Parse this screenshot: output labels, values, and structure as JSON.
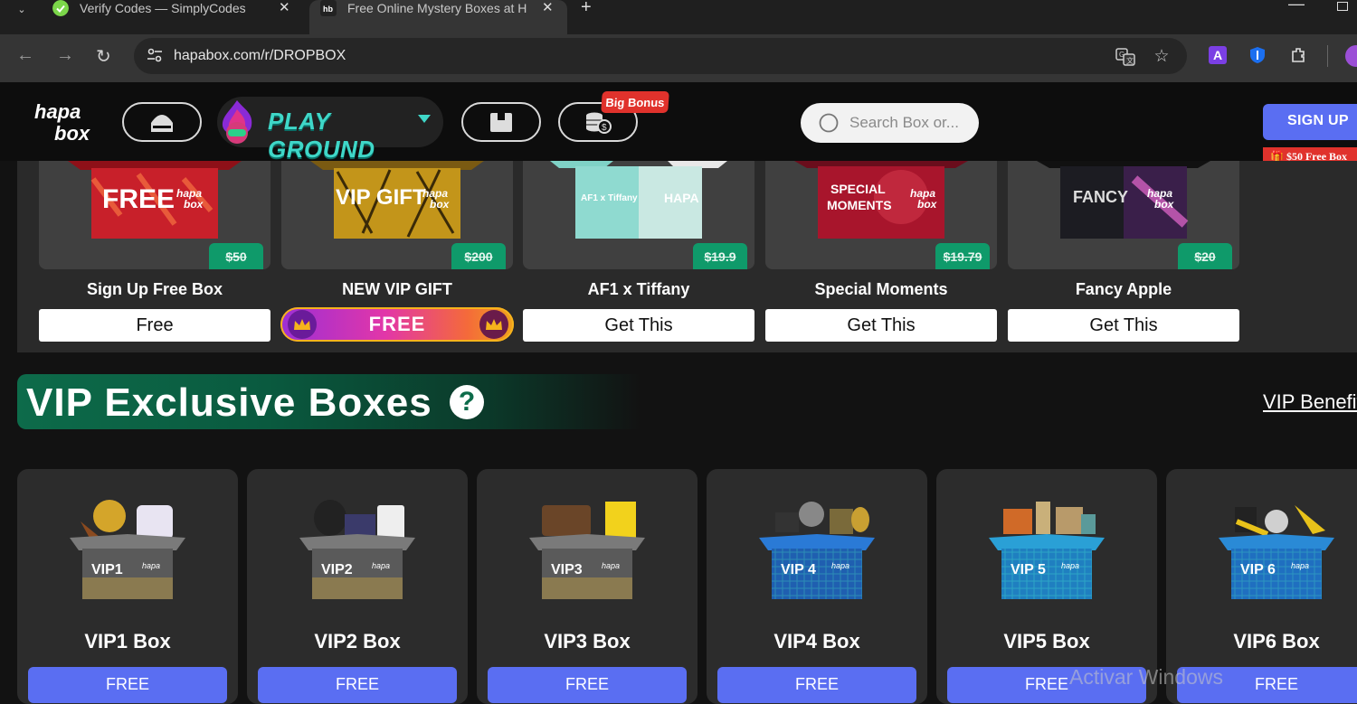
{
  "browser": {
    "tabs": [
      {
        "title": "Verify Codes — SimplyCodes",
        "active": false
      },
      {
        "title": "Free Online Mystery Boxes at H",
        "active": true
      }
    ],
    "new_tab": "+",
    "url": "hapabox.com/r/DROPBOX",
    "icons": [
      "tab-list-icon",
      "back-icon",
      "forward-icon",
      "reload-icon",
      "site-info-icon",
      "translate-icon",
      "bookmark-star-icon",
      "extension-a-icon",
      "bitwarden-icon",
      "extensions-puzzle-icon",
      "profile-icon",
      "minimize-icon",
      "restore-icon"
    ]
  },
  "header": {
    "logo_text": "hapa box",
    "playground_label": "PLAY GROUND",
    "bonus_badge": "Big Bonus",
    "search_placeholder": "Search Box or...",
    "signup_label": "SIGN UP",
    "signup_promo": "🎁 $50 Free Box",
    "accent": "#5a6ef2",
    "icons": [
      "home-icon",
      "store-icon",
      "coins-icon",
      "search-icon"
    ]
  },
  "free_boxes": [
    {
      "name": "Sign Up Free Box",
      "price": "$50",
      "button": "Free",
      "art_text": "FREE",
      "color": "#c8202a"
    },
    {
      "name": "NEW VIP GIFT",
      "price": "$200",
      "button": "FREE",
      "art_text": "VIP GIFT",
      "color": "#d3a21f"
    },
    {
      "name": "AF1 x Tiffany",
      "price": "$19.9",
      "button": "Get This",
      "art_text": "AF1 x Tiffany",
      "color": "#8fdad0"
    },
    {
      "name": "Special Moments",
      "price": "$19.79",
      "button": "Get This",
      "art_text": "SPECIAL MOMENTS",
      "color": "#b0172f"
    },
    {
      "name": "Fancy Apple",
      "price": "$20",
      "button": "Get This",
      "art_text": "FANCY",
      "color": "#2a2a36"
    }
  ],
  "vip": {
    "title": "VIP Exclusive Boxes",
    "help": "?",
    "benefits_link": "VIP Benefits",
    "boxes": [
      {
        "name": "VIP1 Box",
        "button": "FREE",
        "label": "VIP1",
        "tint": "#6a6a6a"
      },
      {
        "name": "VIP2 Box",
        "button": "FREE",
        "label": "VIP2",
        "tint": "#6a6a6a"
      },
      {
        "name": "VIP3 Box",
        "button": "FREE",
        "label": "VIP3",
        "tint": "#6a6a6a"
      },
      {
        "name": "VIP4 Box",
        "button": "FREE",
        "label": "VIP 4",
        "tint": "#1f6fd0"
      },
      {
        "name": "VIP5 Box",
        "button": "FREE",
        "label": "VIP 5",
        "tint": "#1f9ad0"
      },
      {
        "name": "VIP6 Box",
        "button": "FREE",
        "label": "VIP 6",
        "tint": "#1f7fd0"
      }
    ]
  },
  "watermark": "Activar Windows",
  "colors": {
    "price_green": "#0f9a6a",
    "banner_green": "#0d6b4a",
    "badge_red": "#e0322c",
    "playground_teal": "#3fd7c8"
  }
}
